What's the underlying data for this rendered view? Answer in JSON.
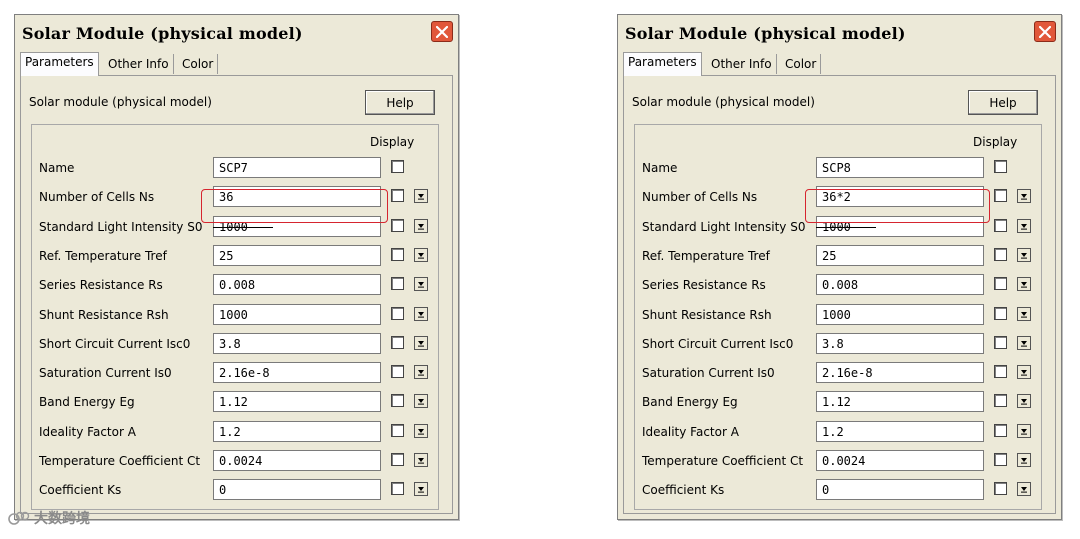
{
  "colors": {
    "accent_highlight": "#d6252f",
    "window_bg": "#ece9d8",
    "close_button": "#e1573a"
  },
  "windows": [
    {
      "title": "Solar Module (physical model)",
      "tabs": [
        "Parameters",
        "Other Info",
        "Color"
      ],
      "active_tab": "Parameters",
      "description": "Solar module (physical model)",
      "help_label": "Help",
      "display_label": "Display",
      "rows": [
        {
          "label": "Name",
          "value": "SCP7"
        },
        {
          "label": "Number of Cells Ns",
          "value": "36"
        },
        {
          "label": "Standard Light Intensity S0",
          "value": "1000"
        },
        {
          "label": "Ref. Temperature Tref",
          "value": "25"
        },
        {
          "label": "Series Resistance Rs",
          "value": "0.008"
        },
        {
          "label": "Shunt Resistance Rsh",
          "value": "1000"
        },
        {
          "label": "Short Circuit Current Isc0",
          "value": "3.8"
        },
        {
          "label": "Saturation Current Is0",
          "value": "2.16e-8"
        },
        {
          "label": "Band Energy Eg",
          "value": "1.12"
        },
        {
          "label": "Ideality Factor A",
          "value": "1.2"
        },
        {
          "label": "Temperature Coefficient Ct",
          "value": "0.0024"
        },
        {
          "label": "Coefficient Ks",
          "value": "0"
        }
      ]
    },
    {
      "title": "Solar Module (physical model)",
      "tabs": [
        "Parameters",
        "Other Info",
        "Color"
      ],
      "active_tab": "Parameters",
      "description": "Solar module (physical model)",
      "help_label": "Help",
      "display_label": "Display",
      "rows": [
        {
          "label": "Name",
          "value": "SCP8"
        },
        {
          "label": "Number of Cells Ns",
          "value": "36*2"
        },
        {
          "label": "Standard Light Intensity S0",
          "value": "1000"
        },
        {
          "label": "Ref. Temperature Tref",
          "value": "25"
        },
        {
          "label": "Series Resistance Rs",
          "value": "0.008"
        },
        {
          "label": "Shunt Resistance Rsh",
          "value": "1000"
        },
        {
          "label": "Short Circuit Current Isc0",
          "value": "3.8"
        },
        {
          "label": "Saturation Current Is0",
          "value": "2.16e-8"
        },
        {
          "label": "Band Energy Eg",
          "value": "1.12"
        },
        {
          "label": "Ideality Factor A",
          "value": "1.2"
        },
        {
          "label": "Temperature Coefficient Ct",
          "value": "0.0024"
        },
        {
          "label": "Coefficient Ks",
          "value": "0"
        }
      ]
    }
  ],
  "watermark": {
    "icon": "logo-icon",
    "text": "大数跨境"
  }
}
